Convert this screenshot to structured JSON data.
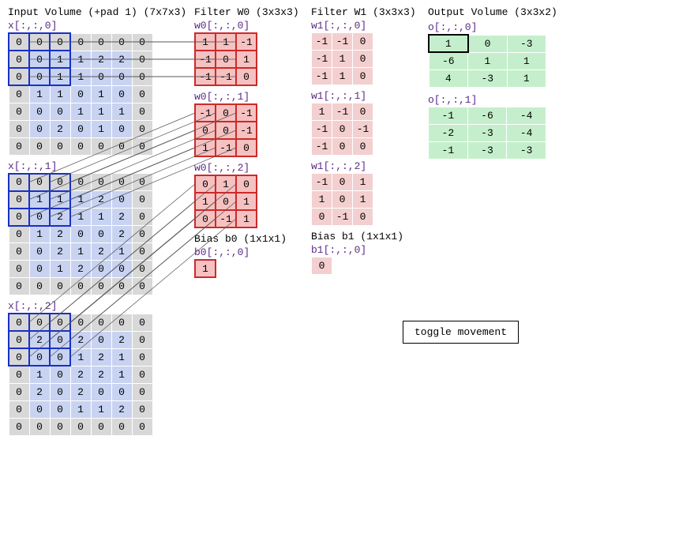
{
  "input": {
    "title": "Input Volume (+pad 1) (7x7x3)",
    "selection": {
      "row0": 0,
      "col0": 0,
      "size": 3
    },
    "slices": [
      {
        "label": "x[:,:,0]",
        "rows": [
          [
            0,
            0,
            0,
            0,
            0,
            0,
            0
          ],
          [
            0,
            0,
            1,
            1,
            2,
            2,
            0
          ],
          [
            0,
            0,
            1,
            1,
            0,
            0,
            0
          ],
          [
            0,
            1,
            1,
            0,
            1,
            0,
            0
          ],
          [
            0,
            0,
            0,
            1,
            1,
            1,
            0
          ],
          [
            0,
            0,
            2,
            0,
            1,
            0,
            0
          ],
          [
            0,
            0,
            0,
            0,
            0,
            0,
            0
          ]
        ]
      },
      {
        "label": "x[:,:,1]",
        "rows": [
          [
            0,
            0,
            0,
            0,
            0,
            0,
            0
          ],
          [
            0,
            1,
            1,
            1,
            2,
            0,
            0
          ],
          [
            0,
            0,
            2,
            1,
            1,
            2,
            0
          ],
          [
            0,
            1,
            2,
            0,
            0,
            2,
            0
          ],
          [
            0,
            0,
            2,
            1,
            2,
            1,
            0
          ],
          [
            0,
            0,
            1,
            2,
            0,
            0,
            0
          ],
          [
            0,
            0,
            0,
            0,
            0,
            0,
            0
          ]
        ]
      },
      {
        "label": "x[:,:,2]",
        "rows": [
          [
            0,
            0,
            0,
            0,
            0,
            0,
            0
          ],
          [
            0,
            2,
            0,
            2,
            0,
            2,
            0
          ],
          [
            0,
            0,
            0,
            1,
            2,
            1,
            0
          ],
          [
            0,
            1,
            0,
            2,
            2,
            1,
            0
          ],
          [
            0,
            2,
            0,
            2,
            0,
            0,
            0
          ],
          [
            0,
            0,
            0,
            1,
            1,
            2,
            0
          ],
          [
            0,
            0,
            0,
            0,
            0,
            0,
            0
          ]
        ]
      }
    ]
  },
  "w0": {
    "title": "Filter W0 (3x3x3)",
    "slices": [
      {
        "label": "w0[:,:,0]",
        "rows": [
          [
            1,
            1,
            -1
          ],
          [
            -1,
            0,
            1
          ],
          [
            -1,
            -1,
            0
          ]
        ]
      },
      {
        "label": "w0[:,:,1]",
        "rows": [
          [
            -1,
            0,
            -1
          ],
          [
            0,
            0,
            -1
          ],
          [
            1,
            -1,
            0
          ]
        ]
      },
      {
        "label": "w0[:,:,2]",
        "rows": [
          [
            0,
            1,
            0
          ],
          [
            1,
            0,
            1
          ],
          [
            0,
            -1,
            1
          ]
        ]
      }
    ],
    "bias_title": "Bias b0 (1x1x1)",
    "bias_label": "b0[:,:,0]",
    "bias_value": 1
  },
  "w1": {
    "title": "Filter W1 (3x3x3)",
    "slices": [
      {
        "label": "w1[:,:,0]",
        "rows": [
          [
            -1,
            -1,
            0
          ],
          [
            -1,
            1,
            0
          ],
          [
            -1,
            1,
            0
          ]
        ]
      },
      {
        "label": "w1[:,:,1]",
        "rows": [
          [
            1,
            -1,
            0
          ],
          [
            -1,
            0,
            -1
          ],
          [
            -1,
            0,
            0
          ]
        ]
      },
      {
        "label": "w1[:,:,2]",
        "rows": [
          [
            -1,
            0,
            1
          ],
          [
            1,
            0,
            1
          ],
          [
            0,
            -1,
            0
          ]
        ]
      }
    ],
    "bias_title": "Bias b1 (1x1x1)",
    "bias_label": "b1[:,:,0]",
    "bias_value": 0
  },
  "output": {
    "title": "Output Volume (3x3x2)",
    "selected": {
      "slice": 0,
      "row": 0,
      "col": 0
    },
    "slices": [
      {
        "label": "o[:,:,0]",
        "rows": [
          [
            1,
            0,
            -3
          ],
          [
            -6,
            1,
            1
          ],
          [
            4,
            -3,
            1
          ]
        ]
      },
      {
        "label": "o[:,:,1]",
        "rows": [
          [
            -1,
            -6,
            -4
          ],
          [
            -2,
            -3,
            -4
          ],
          [
            -1,
            -3,
            -3
          ]
        ]
      }
    ]
  },
  "button": {
    "label": "toggle movement"
  }
}
